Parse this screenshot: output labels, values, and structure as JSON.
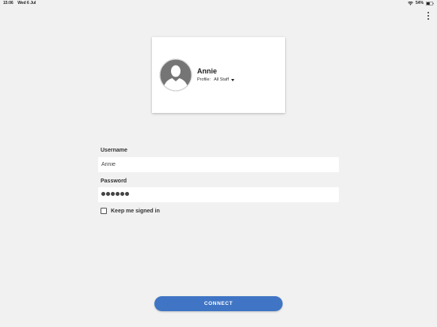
{
  "status_bar": {
    "time": "15:06",
    "date": "Wed 6 Jul",
    "battery_percent": "54%",
    "battery_level": 0.54
  },
  "profile": {
    "name": "Annie",
    "profile_label": "Profile:",
    "profile_value": "All Staff"
  },
  "form": {
    "username_label": "Username",
    "username_value": "Annie",
    "password_label": "Password",
    "password_length": 6,
    "keep_signed_in_label": "Keep me signed in",
    "keep_signed_in_checked": false
  },
  "connect_label": "CONNECT",
  "colors": {
    "background": "#f1f1f1",
    "accent": "#3f75c4",
    "avatar": "#757575"
  },
  "icons": {
    "menu": "more-vertical-icon",
    "avatar": "user-silhouette-icon",
    "dropdown": "caret-down-icon",
    "wifi": "wifi-icon",
    "battery": "battery-icon"
  }
}
